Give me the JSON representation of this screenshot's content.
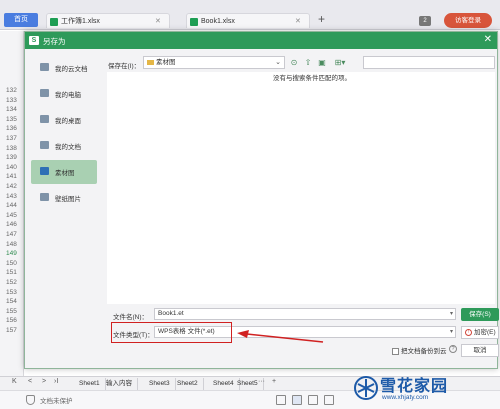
{
  "tabs": {
    "home": "首页",
    "doc1": "工作簿1.xlsx",
    "doc2": "Book1.xlsx",
    "add": "+",
    "page_count": "2",
    "login": "访客登录"
  },
  "row_numbers": [
    "132",
    "133",
    "134",
    "135",
    "136",
    "137",
    "138",
    "139",
    "140",
    "141",
    "142",
    "143",
    "144",
    "145",
    "146",
    "147",
    "148",
    "149",
    "150",
    "151",
    "152",
    "153",
    "154",
    "155",
    "156",
    "157"
  ],
  "active_row": "149",
  "dialog": {
    "title": "另存为",
    "close": "✕",
    "sidebar": [
      {
        "label": "我的云文档",
        "icon": "cloud-icon"
      },
      {
        "label": "我的电脑",
        "icon": "computer-icon"
      },
      {
        "label": "我的桌面",
        "icon": "desktop-icon"
      },
      {
        "label": "我的文档",
        "icon": "documents-icon"
      },
      {
        "label": "素材图",
        "icon": "folder-icon"
      },
      {
        "label": "壁纸图片",
        "icon": "folder-icon"
      }
    ],
    "location_label": "保存在(I)：",
    "location_value": "素材图",
    "no_match_text": "没有与搜索条件匹配的项。",
    "filename_label": "文件名(N)：",
    "filename_value": "Book1.et",
    "filetype_label": "文件类型(T)：",
    "filetype_value": "WPS表格 文件(*.et)",
    "save_button": "保存(S)",
    "encrypt_button": "加密(E)",
    "cancel_button": "取消",
    "backup_label": "把文档备份到云",
    "help": "?"
  },
  "sheetbar": {
    "nav": [
      "K",
      "<",
      ">",
      "›I"
    ],
    "tabs": [
      "Sheet1",
      "输入内容",
      "Sheet3",
      "Sheet2",
      "Sheet4",
      "Sheet5"
    ],
    "more": "···",
    "add": "+"
  },
  "status": {
    "protection": "文档未保护"
  },
  "watermark": {
    "name": "雪花家园",
    "url": "www.xhjaty.com"
  },
  "colors": {
    "accent": "#2e9a5a",
    "highlight": "#d02121"
  }
}
